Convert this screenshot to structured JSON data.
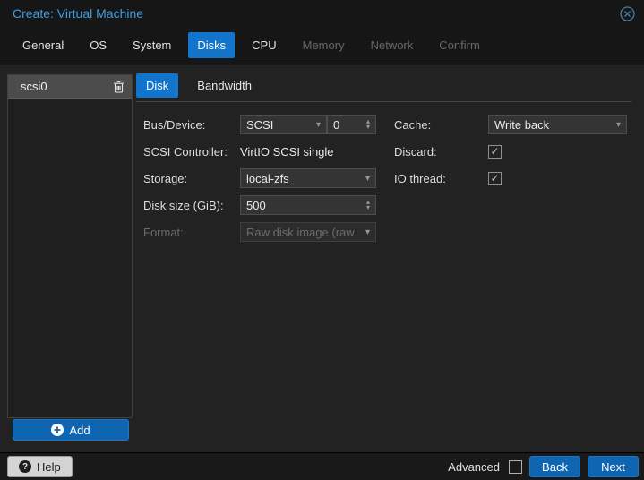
{
  "window": {
    "title": "Create: Virtual Machine"
  },
  "icons": {
    "close": "close-circle-icon",
    "trash": "trash-icon",
    "add": "plus-circle-icon",
    "help_glyph": "?",
    "chevron_down": "▾",
    "spin_up": "▴",
    "spin_down": "▾"
  },
  "tabs": [
    {
      "label": "General",
      "state": "normal"
    },
    {
      "label": "OS",
      "state": "normal"
    },
    {
      "label": "System",
      "state": "normal"
    },
    {
      "label": "Disks",
      "state": "active"
    },
    {
      "label": "CPU",
      "state": "normal"
    },
    {
      "label": "Memory",
      "state": "disabled"
    },
    {
      "label": "Network",
      "state": "disabled"
    },
    {
      "label": "Confirm",
      "state": "disabled"
    }
  ],
  "disk_panel": {
    "items": [
      {
        "name": "scsi0"
      }
    ],
    "add_label": "Add"
  },
  "subtabs": [
    {
      "label": "Disk",
      "state": "active"
    },
    {
      "label": "Bandwidth",
      "state": "normal"
    }
  ],
  "form": {
    "bus_device": {
      "label": "Bus/Device:",
      "combo_value": "SCSI",
      "spinner_value": "0"
    },
    "scsi_controller": {
      "label": "SCSI Controller:",
      "value": "VirtIO SCSI single"
    },
    "storage": {
      "label": "Storage:",
      "value": "local-zfs"
    },
    "disk_size": {
      "label": "Disk size (GiB):",
      "value": "500"
    },
    "format": {
      "label": "Format:",
      "value": "Raw disk image (raw",
      "disabled": true
    },
    "cache": {
      "label": "Cache:",
      "value": "Write back"
    },
    "discard": {
      "label": "Discard:",
      "checked": true,
      "glyph": "✓"
    },
    "io_thread": {
      "label": "IO thread:",
      "checked": true,
      "glyph": "✓"
    }
  },
  "footer": {
    "help_label": "Help",
    "advanced_label": "Advanced",
    "advanced_checked": false,
    "advanced_glyph": "",
    "back_label": "Back",
    "next_label": "Next"
  },
  "colors": {
    "accent_tab_blue": "#1374cb",
    "button_blue": "#1065b0",
    "title_blue": "#3e9de2",
    "bg_header": "#161616",
    "bg_content": "#222222",
    "bg_field": "#343434",
    "border_gray": "#4a4a4a"
  }
}
